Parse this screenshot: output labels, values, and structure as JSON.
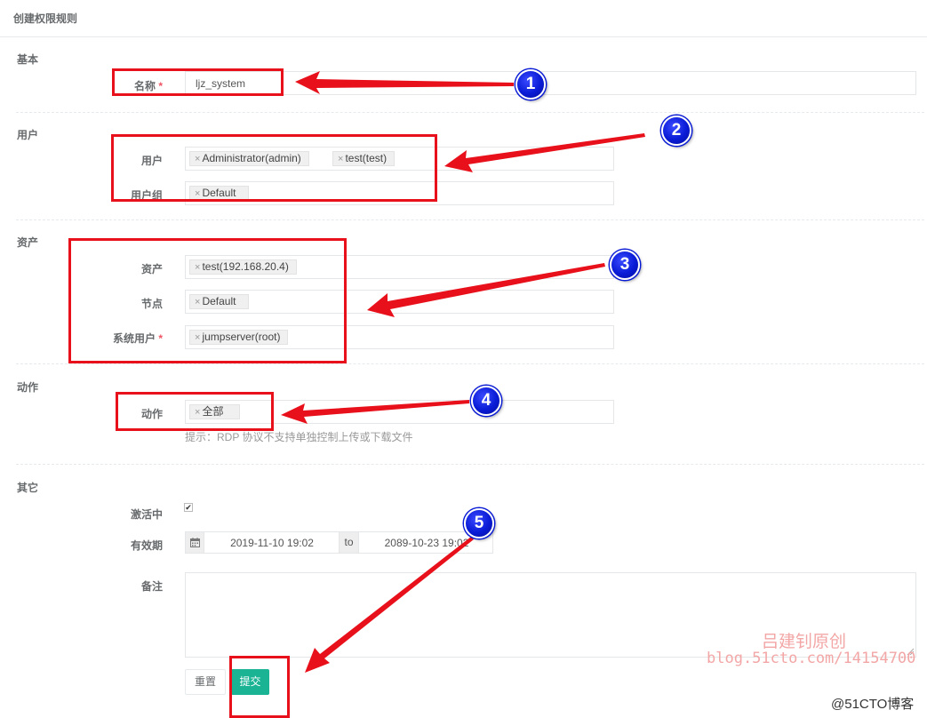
{
  "panel": {
    "title": "创建权限规则"
  },
  "sections": {
    "basic": "基本",
    "user": "用户",
    "asset": "资产",
    "action": "动作",
    "other": "其它"
  },
  "basic": {
    "name_label": "名称",
    "required_mark": "*",
    "name_value": "ljz_system"
  },
  "users": {
    "users_label": "用户",
    "user_chips": [
      "Administrator(admin)",
      "test(test)"
    ],
    "groups_label": "用户组",
    "group_chips": [
      "Default"
    ]
  },
  "assets": {
    "assets_label": "资产",
    "asset_chips": [
      "test(192.168.20.4)"
    ],
    "nodes_label": "节点",
    "node_chips": [
      "Default"
    ],
    "system_users_label": "系统用户",
    "system_user_chips": [
      "jumpserver(root)"
    ]
  },
  "actions": {
    "label": "动作",
    "chips": [
      "全部"
    ],
    "hint": "提示：RDP 协议不支持单独控制上传或下载文件"
  },
  "other": {
    "active_label": "激活中",
    "active_checked": true,
    "expiry_label": "有效期",
    "date_start": "2019-11-10 19:02",
    "date_sep": "to",
    "date_end": "2089-10-23 19:02",
    "comment_label": "备注",
    "comment_value": ""
  },
  "buttons": {
    "reset": "重置",
    "submit": "提交"
  },
  "chip_remove": "×",
  "annotations": {
    "badges": [
      "1",
      "2",
      "3",
      "4",
      "5"
    ],
    "color": "#e8101a",
    "badge_color": "#0a1bd6"
  },
  "watermark": {
    "line1": "吕建钊原创",
    "line2": "blog.51cto.com/14154700"
  },
  "credit": "@51CTO博客",
  "icons": {
    "calendar": "calendar-icon",
    "checkbox": "checkbox-icon",
    "remove": "remove-tag-icon",
    "resize": "resize-handle-icon"
  }
}
